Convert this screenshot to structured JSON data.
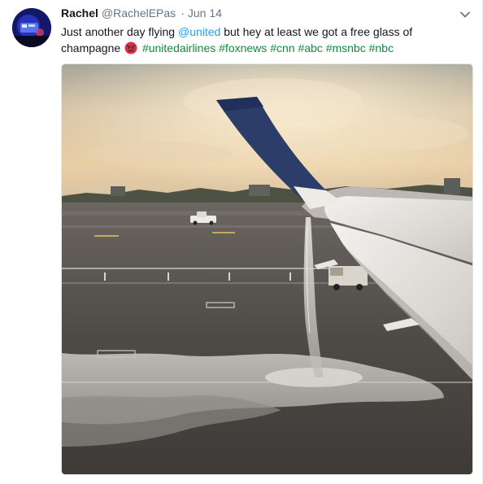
{
  "tweet": {
    "display_name": "Rachel",
    "handle": "@RachelEPas",
    "separator": "·",
    "date": "Jun 14",
    "text_part1": "Just another day flying ",
    "mention": "@united",
    "text_part2": " but hey at least we got a free glass of champagne",
    "hashtags": [
      "#unitedairlines",
      "#foxnews",
      "#cnn",
      "#abc",
      "#msnbc",
      "#nbc"
    ],
    "emoji": "angry-face",
    "caret_icon": "chevron-down-icon",
    "colors": {
      "link": "#1da1f2",
      "hashtag": "#138a3e",
      "muted": "#657786"
    }
  }
}
